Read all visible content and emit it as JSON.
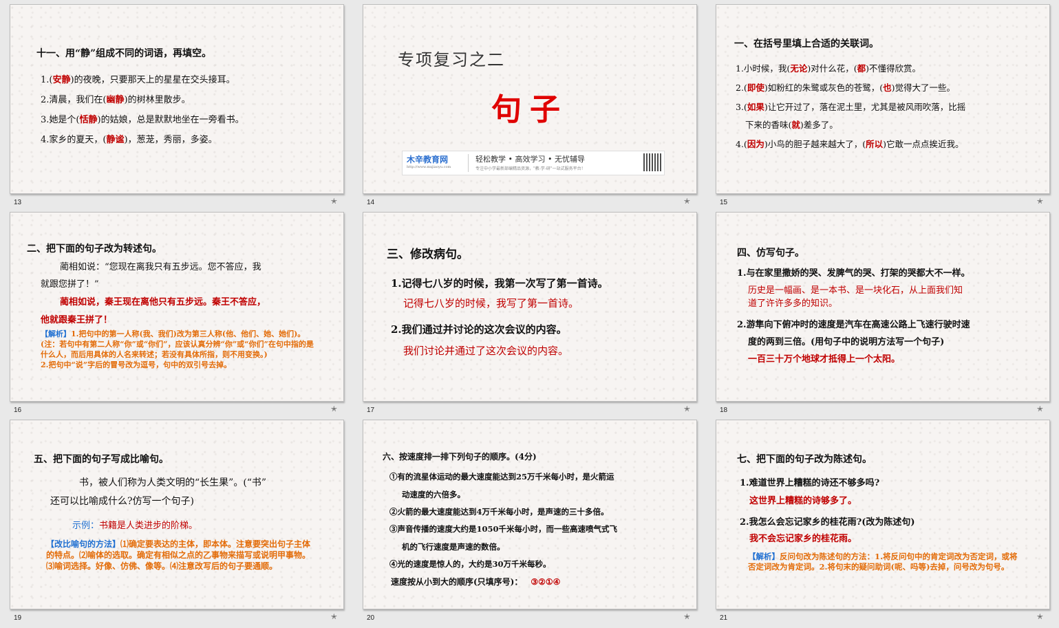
{
  "colors": {
    "answer": "#c00000",
    "note": "#e36c09",
    "tag": "#1f6fd1"
  },
  "slides": [
    {
      "number": "13",
      "title": "十一、用“静”组成不同的词语，再填空。",
      "lines": [
        {
          "pre": "1.(",
          "ans": "安静",
          "post": ")的夜晚，只要那天上的星星在交头接耳。"
        },
        {
          "pre": "2.清晨，我们在(",
          "ans": "幽静",
          "post": ")的树林里散步。"
        },
        {
          "pre": "3.她是个(",
          "ans": "恬静",
          "post": ")的姑娘，总是默默地坐在一旁看书。"
        },
        {
          "pre": "4.家乡的夏天，(",
          "ans": "静谧",
          "post": ")，葱茏，秀丽，多姿。"
        }
      ]
    },
    {
      "number": "14",
      "subtitle": "专项复习之二",
      "title": "句子",
      "logo_name": "木辛教育网",
      "logo_url": "http://www.mxjiaoyu.com",
      "slogan": "轻松教学 • 高效学习 • 无忧辅导",
      "tagline": "专注中小学最新部编精品资源，\"教-学-研\"一站式服务平台！"
    },
    {
      "number": "15",
      "title": "一、在括号里填上合适的关联词。",
      "l1": {
        "a": "1.小时候，我(",
        "b": "无论",
        "c": ")对什么花，(",
        "d": "都",
        "e": ")不懂得欣赏。"
      },
      "l2": {
        "a": "2.(",
        "b": "即使",
        "c": ")如粉红的朱鹭或灰色的苍鹭，(",
        "d": "也",
        "e": ")觉得大了一些。"
      },
      "l3": {
        "a": "3.(",
        "b": "如果",
        "c": ")让它开过了，落在泥土里，尤其是被风雨吹落，比摇"
      },
      "l3b": {
        "a": "下来的香味(",
        "b": "就",
        "c": ")差多了。"
      },
      "l4": {
        "a": "4.(",
        "b": "因为",
        "c": ")小鸟的胆子越来越大了，(",
        "d": "所以",
        "e": ")它敢一点点挨近我。"
      }
    },
    {
      "number": "16",
      "title": "二、把下面的句子改为转述句。",
      "q1": "蔺相如说：“您现在离我只有五步远。您不答应，我",
      "q2": "就跟您拼了！”",
      "a1": "蔺相如说，秦王现在离他只有五步远。秦王不答应，",
      "a2": "他就跟秦王拼了！",
      "note_tag": "【解析】",
      "note1": "1.把句中的第一人称(我、我们)改为第三人称(他、他们、她、她们)。(注：若句中有第二人称“你”或“你们”，应该认真分辨“你”或“你们”在句中指的是什么人，而后用具体的人名来转述；若没有具体所指，则不用变换。)",
      "note2": "2.把句中“说”字后的冒号改为逗号，句中的双引号去掉。"
    },
    {
      "number": "17",
      "title": "三、修改病句。",
      "q1": "1.记得七八岁的时候，我第一次写了第一首诗。",
      "a1": "记得七八岁的时候，我写了第一首诗。",
      "q2": "2.我们通过并讨论的这次会议的内容。",
      "a2": "我们讨论并通过了这次会议的内容。"
    },
    {
      "number": "18",
      "title": "四、仿写句子。",
      "q1": "1.与在家里撒娇的哭、发脾气的哭、打架的哭都大不一样。",
      "a1a": "历史是一幅画、是一本书、是一块化石，从上面我们知",
      "a1b": "道了许许多多的知识。",
      "q2a": "2.游隼向下俯冲时的速度是汽车在高速公路上飞速行驶时速",
      "q2b": "度的两到三倍。(用句子中的说明方法写一个句子)",
      "a2": "一百三十万个地球才抵得上一个太阳。"
    },
    {
      "number": "19",
      "title": "五、把下面的句子写成比喻句。",
      "q1": "书，被人们称为人类文明的“长生果”。(“书”",
      "q2": "还可以比喻成什么?仿写一个句子)",
      "ex_label": "示例：",
      "ex": "书籍是人类进步的阶梯。",
      "m_tag": "【改比喻句的方法】",
      "m_text": "⑴确定要表达的主体，即本体。注意要突出句子主体的特点。⑵喻体的选取。确定有相似之点的乙事物来描写或说明甲事物。⑶喻词选择。好像、仿佛、像等。⑷注意改写后的句子要通顺。"
    },
    {
      "number": "20",
      "title": "六、按速度排一排下列句子的顺序。(4分)",
      "s1a": "①有的流星体运动的最大速度能达到25万千米每小时，是火箭运",
      "s1b": "动速度的六倍多。",
      "s2": "②火箭的最大速度能达到4万千米每小时，是声速的三十多倍。",
      "s3a": "③声音传播的速度大约是1050千米每小时，而一些高速喷气式飞",
      "s3b": "机的飞行速度是声速的数倍。",
      "s4": "④光的速度是惊人的，大约是30万千米每秒。",
      "q": "速度按从小到大的顺序(只填序号)：",
      "ans": "③②①④"
    },
    {
      "number": "21",
      "title": "七、把下面的句子改为陈述句。",
      "q1": "1.难道世界上糟糕的诗还不够多吗?",
      "a1": "这世界上糟糕的诗够多了。",
      "q2": "2.我怎么会忘记家乡的桂花雨?(改为陈述句)",
      "a2": "我不会忘记家乡的桂花雨。",
      "note_tag": "【解析】",
      "note": "反问句改为陈述句的方法：1.将反问句中的肯定词改为否定词，或将否定词改为肯定词。2.将句末的疑问助词(呢、吗等)去掉，问号改为句号。"
    }
  ]
}
